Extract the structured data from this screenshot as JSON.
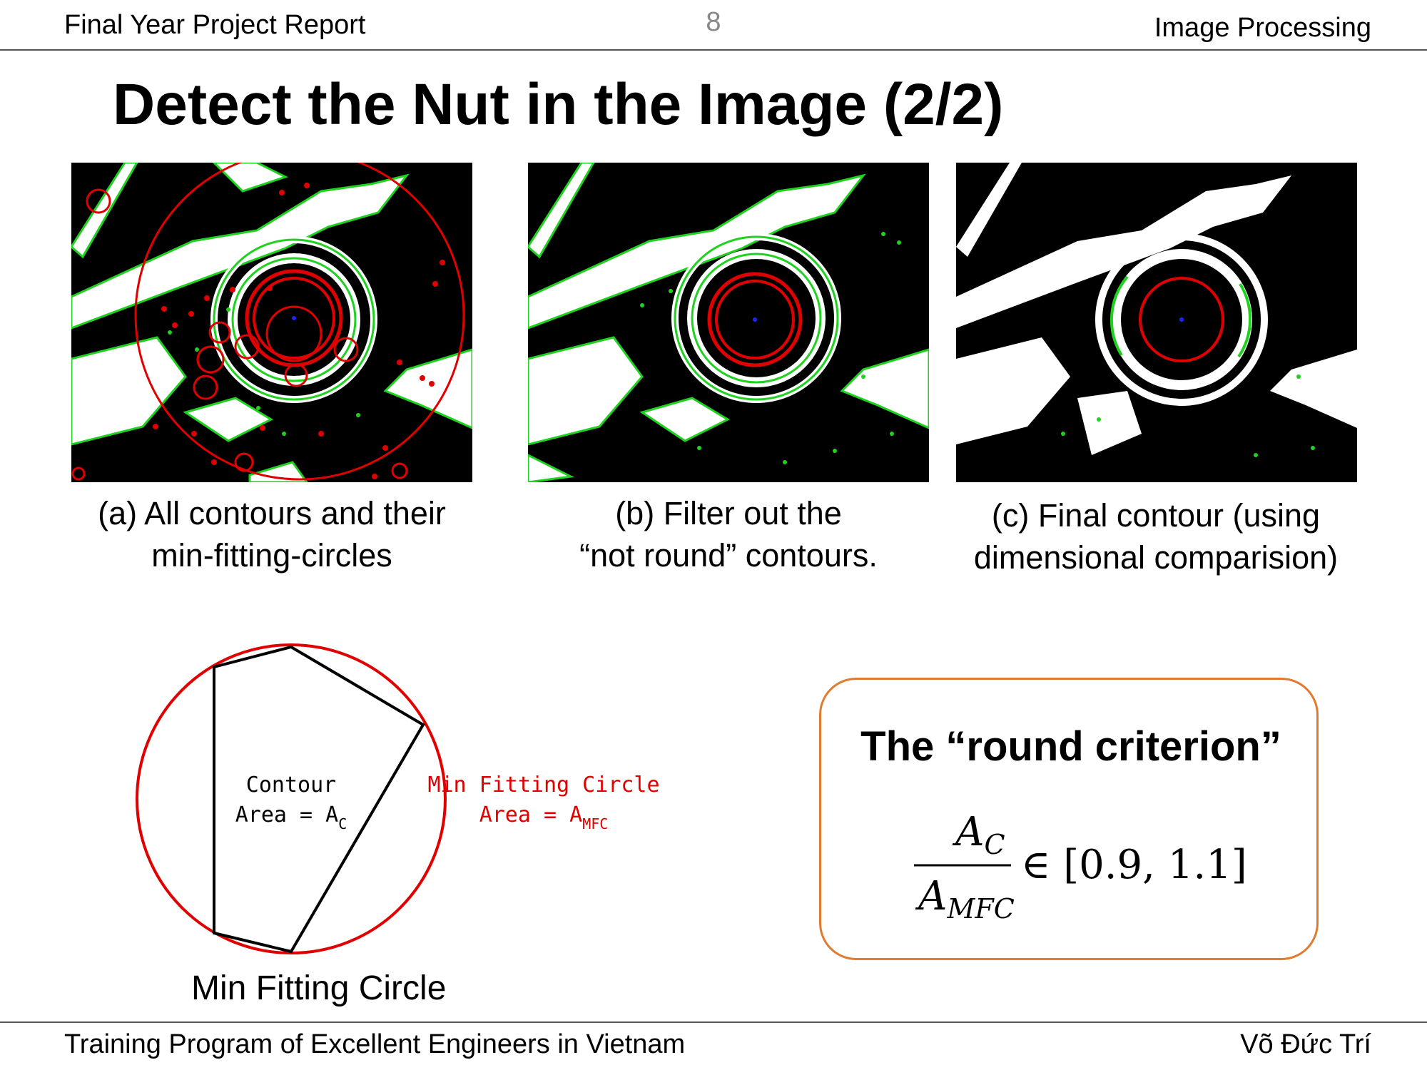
{
  "header": {
    "left": "Final Year Project Report",
    "page_number": "8",
    "right": "Image Processing"
  },
  "slide": {
    "title": "Detect the Nut in the Image (2/2)"
  },
  "panels": [
    {
      "caption_line1": "(a) All contours and their",
      "caption_line2": "min-fitting-circles"
    },
    {
      "caption_line1": "(b) Filter out the",
      "caption_line2": "“not round” contours."
    },
    {
      "caption_line1": "(c) Final contour (using",
      "caption_line2": "dimensional comparision)"
    }
  ],
  "diagram": {
    "contour_label": "Contour",
    "contour_area_label": "Area = A",
    "contour_area_sub": "C",
    "mfc_label": "Min Fitting Circle",
    "mfc_area_label": "Area = A",
    "mfc_area_sub": "MFC",
    "caption": "Min Fitting Circle"
  },
  "criterion": {
    "title": "The “round criterion”",
    "numerator": "A",
    "numerator_sub": "C",
    "denominator": "A",
    "denominator_sub": "MFC",
    "relation": "∈ [0.9, 1.1]"
  },
  "footer": {
    "left": "Training Program of Excellent Engineers in Vietnam",
    "right": "Võ Đức Trí"
  },
  "colors": {
    "accent_red": "#e00000",
    "contour_green": "#1fd21f",
    "box_border": "#e07b30"
  }
}
